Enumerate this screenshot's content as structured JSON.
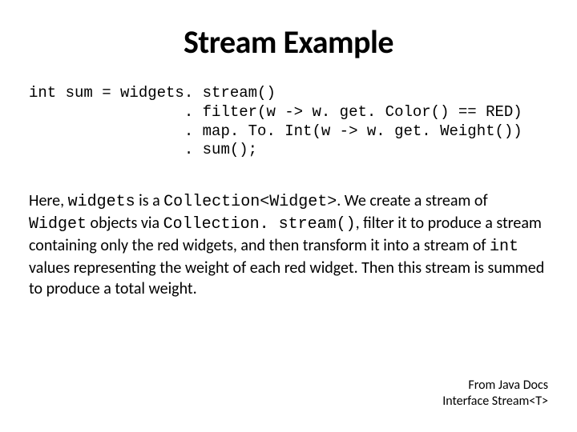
{
  "title": "Stream Example",
  "code": {
    "line1": "int sum = widgets. stream()",
    "line2": "                 . filter(w -> w. get. Color() == RED)",
    "line3": "                 . map. To. Int(w -> w. get. Weight())",
    "line4": "                 . sum();"
  },
  "body": {
    "t1": "Here, ",
    "c1": "widgets",
    "t2": " is a ",
    "c2": "Collection<Widget>",
    "t3": ". We create a stream of ",
    "c3": "Widget",
    "t4": " objects via ",
    "c4": "Collection. stream()",
    "t5": ", filter it to produce a stream containing only the red widgets, and then transform it into a stream of ",
    "c5": "int",
    "t6": " values representing the weight of each red widget. Then this stream is summed to produce a total weight."
  },
  "footer": {
    "line1": "From Java Docs",
    "line2": "Interface Stream<T>"
  }
}
